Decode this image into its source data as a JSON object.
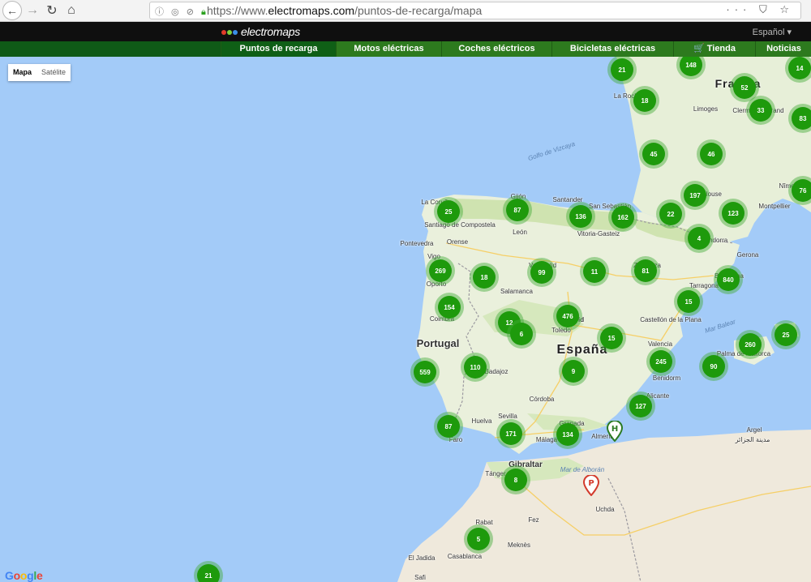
{
  "browser": {
    "url_prefix": "https://www.",
    "url_domain": "electromaps.com",
    "url_path": "/puntos-de-recarga/mapa"
  },
  "header": {
    "logo_text": "electromaps",
    "language": "Español ▾"
  },
  "nav": [
    "Puntos de recarga",
    "Motos eléctricas",
    "Coches eléctricos",
    "Bicicletas eléctricas",
    "🛒 Tienda",
    "Noticias"
  ],
  "map": {
    "type_selected": "Mapa",
    "type_other": "Satélite",
    "attribution": "Google",
    "region_labels": [
      "Francia",
      "España",
      "Portugal"
    ],
    "water_labels": [
      "Golfo de Vizcaya",
      "Mar Balear",
      "Mar de Alborán"
    ],
    "place_labels": [
      "La Coruña",
      "Santiago de Compostela",
      "Pontevedra",
      "Vigo",
      "Orense",
      "Oporto",
      "Coimbra",
      "Gijón",
      "León",
      "Santander",
      "San Sebastián",
      "Vitoria-Gasteiz",
      "Valladolid",
      "Salamanca",
      "Zaragoza",
      "Barcelona",
      "Tarragona",
      "Andorra",
      "Gerona",
      "Toulouse",
      "Montpellier",
      "Nîmes",
      "Limoges",
      "Clermont-Ferrand",
      "La Rochelle",
      "Madrid",
      "Toledo",
      "Castellón de la Plana",
      "Valencia",
      "Benidorm",
      "Alicante",
      "Palma de Mallorca",
      "Badajoz",
      "Córdoba",
      "Sevilla",
      "Huelva",
      "Faro",
      "Granada",
      "Málaga",
      "Almería",
      "Gibraltar",
      "Tánger",
      "Fez",
      "Meknès",
      "Rabat",
      "Casablanca",
      "El Jadida",
      "Safi",
      "Argel",
      "Uchda",
      "مدينة الجزائر"
    ],
    "clusters": [
      "21",
      "148",
      "52",
      "14",
      "18",
      "33",
      "83",
      "45",
      "46",
      "197",
      "76",
      "25",
      "87",
      "136",
      "162",
      "22",
      "123",
      "4",
      "269",
      "18",
      "99",
      "11",
      "81",
      "840",
      "154",
      "15",
      "12",
      "6",
      "476",
      "15",
      "25",
      "260",
      "559",
      "110",
      "9",
      "245",
      "90",
      "127",
      "87",
      "171",
      "134",
      "8",
      "5",
      "21"
    ]
  }
}
